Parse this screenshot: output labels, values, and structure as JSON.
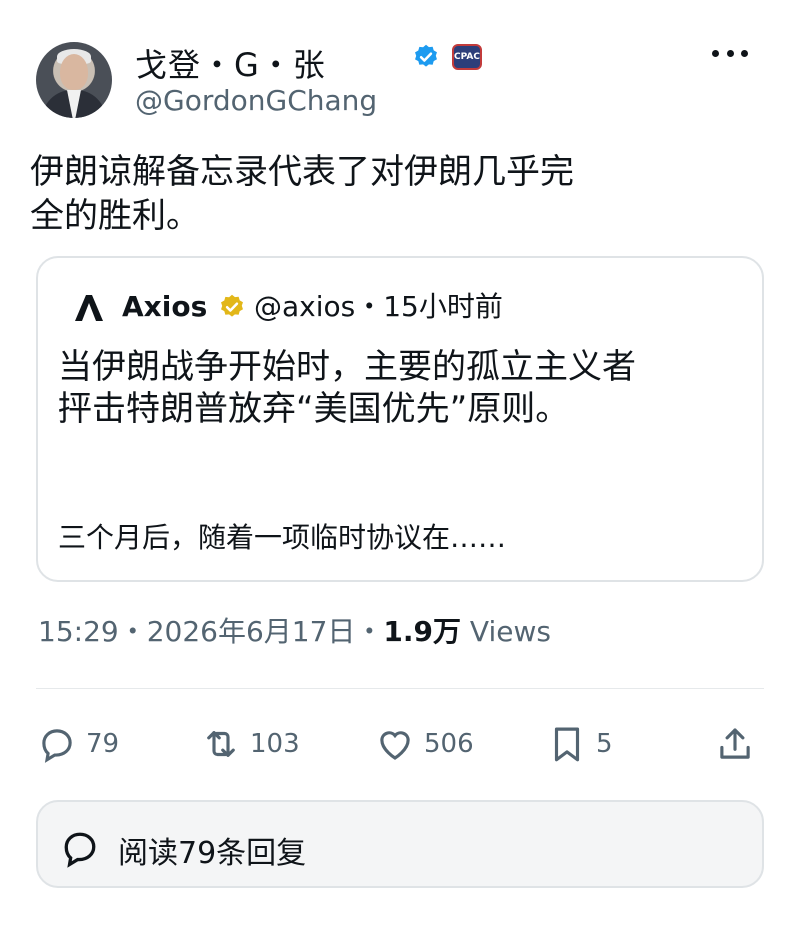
{
  "author": {
    "display_name": "戈登・G・张",
    "handle": "@GordonGChang",
    "badge_text": "CPAC"
  },
  "tweet": {
    "text_line1": "伊朗谅解备忘录代表了对伊朗几乎完",
    "text_line2": "全的胜利。"
  },
  "quote": {
    "name": "Axios",
    "handle_time": "@axios・15小时前",
    "text_line1": "当伊朗战争开始时，主要的孤立主义者",
    "text_line2": "抨击特朗普放弃“美国优先”原则。",
    "text_line3": "三个月后，随着一项临时协议在……"
  },
  "meta": {
    "time_date": "15:29・2026年6月17日・",
    "views_count": "1.9万",
    "views_label": " Views"
  },
  "actions": {
    "replies": "79",
    "retweets": "103",
    "likes": "506",
    "bookmarks": "5"
  },
  "read_replies_label": "阅读79条回复",
  "colors": {
    "verified_blue": "#1d9bf0",
    "verified_gold": "#e2b719",
    "secondary_text": "#536471"
  }
}
